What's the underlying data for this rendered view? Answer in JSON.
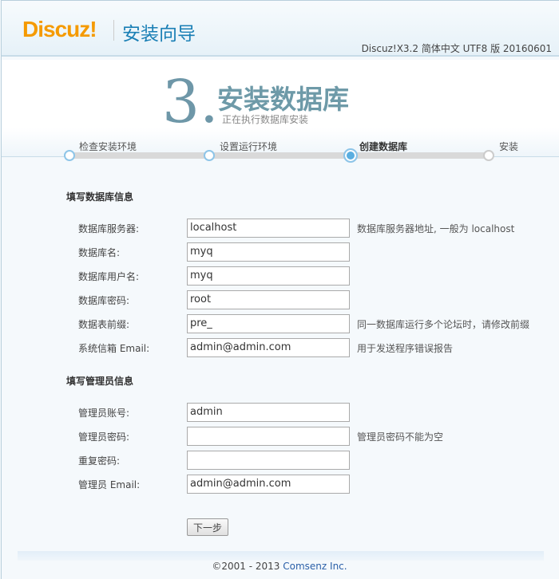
{
  "header": {
    "logo": "Discuz!",
    "title": "安装向导",
    "version": "Discuz!X3.2 简体中文 UTF8 版 20160601"
  },
  "step": {
    "number": "3.",
    "title": "安装数据库",
    "subtitle": "正在执行数据库安装"
  },
  "steps": [
    {
      "label": "检查安装环境",
      "state": "done"
    },
    {
      "label": "设置运行环境",
      "state": "done"
    },
    {
      "label": "创建数据库",
      "state": "current"
    },
    {
      "label": "安装",
      "state": "todo"
    }
  ],
  "db_section": {
    "title": "填写数据库信息",
    "fields": [
      {
        "label": "数据库服务器:",
        "value": "localhost",
        "tip": "数据库服务器地址, 一般为 localhost"
      },
      {
        "label": "数据库名:",
        "value": "myq",
        "tip": ""
      },
      {
        "label": "数据库用户名:",
        "value": "myq",
        "tip": ""
      },
      {
        "label": "数据库密码:",
        "value": "root",
        "tip": ""
      },
      {
        "label": "数据表前缀:",
        "value": "pre_",
        "tip": "同一数据库运行多个论坛时，请修改前缀"
      },
      {
        "label": "系统信箱 Email:",
        "value": "admin@admin.com",
        "tip": "用于发送程序错误报告"
      }
    ]
  },
  "admin_section": {
    "title": "填写管理员信息",
    "fields": [
      {
        "label": "管理员账号:",
        "value": "admin",
        "tip": ""
      },
      {
        "label": "管理员密码:",
        "value": "",
        "tip": "管理员密码不能为空"
      },
      {
        "label": "重复密码:",
        "value": "",
        "tip": ""
      },
      {
        "label": "管理员 Email:",
        "value": "admin@admin.com",
        "tip": ""
      }
    ]
  },
  "next_button": "下一步",
  "footer": {
    "copyright": "©2001 - 2013 ",
    "company": "Comsenz Inc."
  }
}
